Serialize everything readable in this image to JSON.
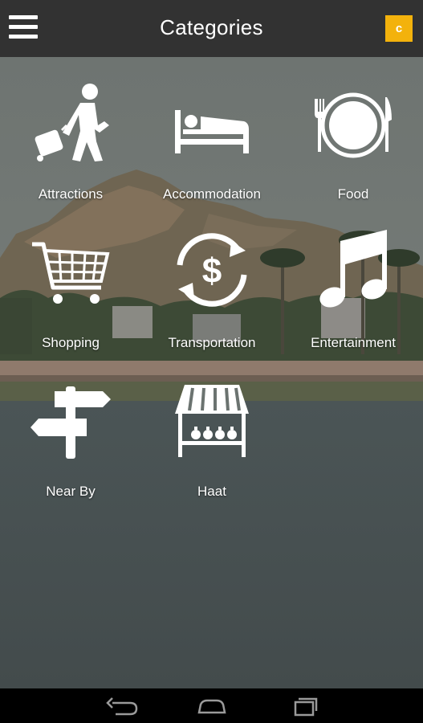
{
  "app": {
    "title": "Categories",
    "badge_letter": "c"
  },
  "colors": {
    "topbar": "#323232",
    "badge": "#f3b20c",
    "navbar": "#000000"
  },
  "categories": [
    {
      "label": "Attractions",
      "icon": "walking-traveler-icon"
    },
    {
      "label": "Accommodation",
      "icon": "bed-icon"
    },
    {
      "label": "Food",
      "icon": "plate-fork-knife-icon"
    },
    {
      "label": "Shopping",
      "icon": "shopping-cart-icon"
    },
    {
      "label": "Transportation",
      "icon": "currency-exchange-icon"
    },
    {
      "label": "Entertainment",
      "icon": "music-note-icon"
    },
    {
      "label": "Near By",
      "icon": "signpost-icon"
    },
    {
      "label": "Haat",
      "icon": "market-stall-icon"
    }
  ],
  "navbar": {
    "buttons": [
      "back-icon",
      "home-icon",
      "recent-apps-icon"
    ]
  }
}
